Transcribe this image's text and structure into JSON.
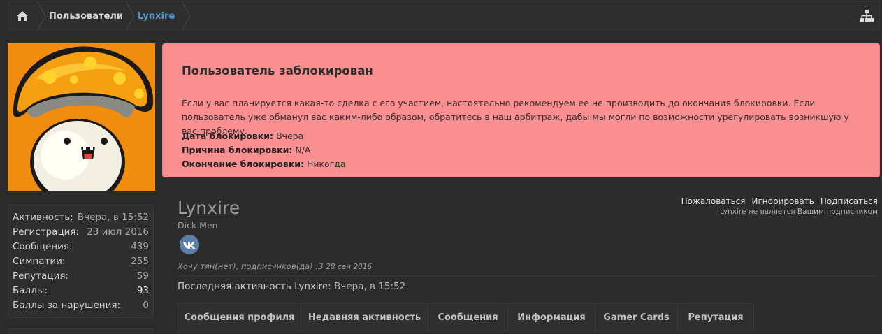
{
  "breadcrumb": {
    "home_icon": "home-icon",
    "items": [
      "Пользователи",
      "Lynxire"
    ],
    "sitemap_icon": "sitemap-icon"
  },
  "alert": {
    "title": "Пользователь заблокирован",
    "text": "Если у вас планируется какая-то сделка с его участием, настоятельно рекомендуем ее не производить до окончания блокировки. Если пользователь уже обманул вас каким-либо образом, обратитесь в наш арбитраж, дабы мы могли по возможности урегулировать возникшую у вас проблему.",
    "date_label": "Дата блокировки:",
    "date_value": "Вчера",
    "reason_label": "Причина блокировки:",
    "reason_value": "N/A",
    "end_label": "Окончание блокировки:",
    "end_value": "Никогда",
    "color": "#fa8f92"
  },
  "stats": [
    {
      "label": "Активность:",
      "value": "Вчера, в 15:52"
    },
    {
      "label": "Регистрация:",
      "value": "23 июл 2016"
    },
    {
      "label": "Сообщения:",
      "value": "439"
    },
    {
      "label": "Симпатии:",
      "value": "255"
    },
    {
      "label": "Репутация:",
      "value": "59"
    },
    {
      "label": "Баллы:",
      "value": "93"
    },
    {
      "label": "Баллы за нарушения:",
      "value": "0"
    }
  ],
  "profile": {
    "username": "Lynxire",
    "user_title": "Dick Men",
    "social_icon": "vk-icon",
    "status": "Хочу тян(нет), подписчиков(да) :3",
    "status_date": "28 сен 2016",
    "last_activity_label": "Последняя активность Lynxire:",
    "last_activity_value": "Вчера, в 15:52"
  },
  "actions": {
    "report": "Пожаловаться",
    "ignore": "Игнорировать",
    "follow": "Подписаться",
    "follow_note": "Lynxire не является Вашим подписчиком"
  },
  "tabs": [
    "Сообщения профиля",
    "Недавняя активность",
    "Сообщения",
    "Информация",
    "Gamer Cards",
    "Репутация"
  ]
}
